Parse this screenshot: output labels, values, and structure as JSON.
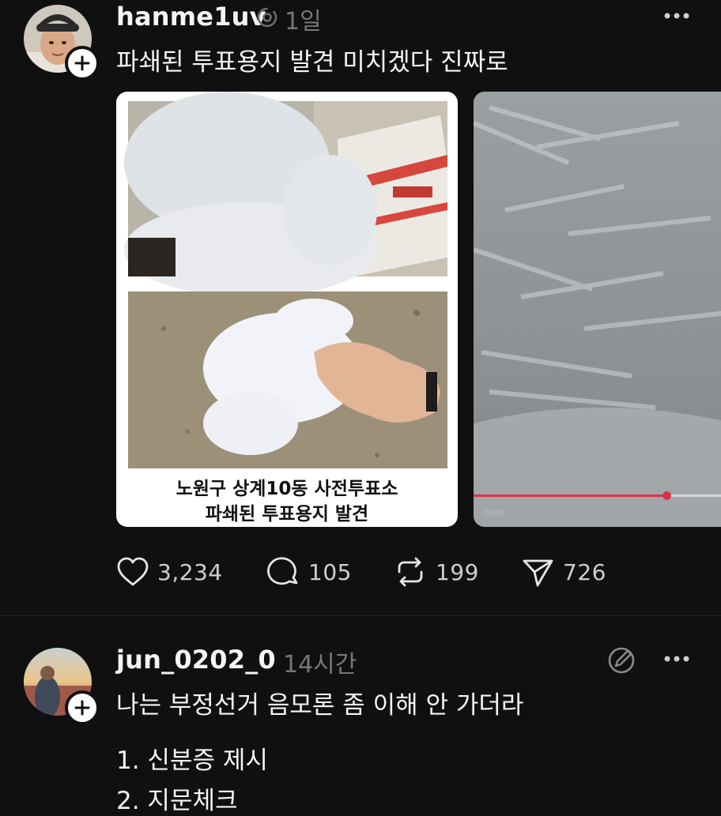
{
  "colors": {
    "background": "#101010",
    "text_primary": "#f3f5f7",
    "text_secondary": "#777777",
    "live_progress": "#e0314b"
  },
  "posts": [
    {
      "username": "hanme1uv",
      "timestamp": "1일",
      "body_lines": [
        "파쇄된 투표용지 발견 미치겠다 진짜로"
      ],
      "media": {
        "image1_caption_line1": "노원구 상계10동 사전투표소",
        "image1_caption_line2": "파쇄된 투표용지 발견",
        "image2_live_label": "라이브",
        "image2_progress": 0.74
      },
      "actions": {
        "likes": "3,234",
        "comments": "105",
        "reposts": "199",
        "shares": "726"
      },
      "icons": [
        "more-icon",
        "threads-badge-icon",
        "heart-icon",
        "comment-icon",
        "repost-icon",
        "send-icon"
      ]
    },
    {
      "username": "jun_0202_0",
      "timestamp": "14시간",
      "body_lines": [
        "나는 부정선거 음모론 좀 이해 안 가더라",
        "1. 신분증 제시",
        "2. 지문체크"
      ],
      "icons": [
        "edit-circle-icon",
        "more-icon"
      ]
    }
  ]
}
